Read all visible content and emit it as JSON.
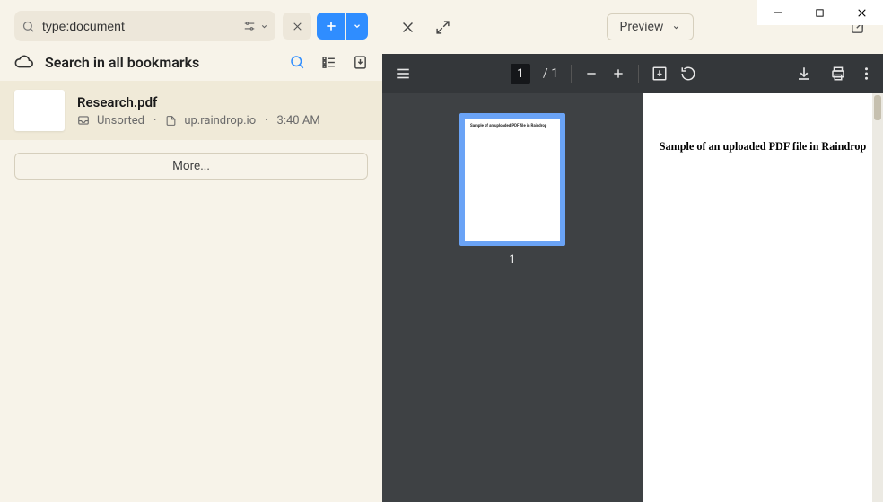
{
  "search": {
    "value": "type:document"
  },
  "header": {
    "title": "Search in all bookmarks"
  },
  "bookmark": {
    "title": "Research.pdf",
    "collection": "Unsorted",
    "domain": "up.raindrop.io",
    "time": "3:40 AM"
  },
  "more_label": "More...",
  "preview": {
    "label": "Preview"
  },
  "pdf": {
    "current_page": "1",
    "total_pages": "1",
    "page_label_sep": "/",
    "thumb_label": "1",
    "document_heading": "Sample of an uploaded PDF file in Raindrop"
  }
}
